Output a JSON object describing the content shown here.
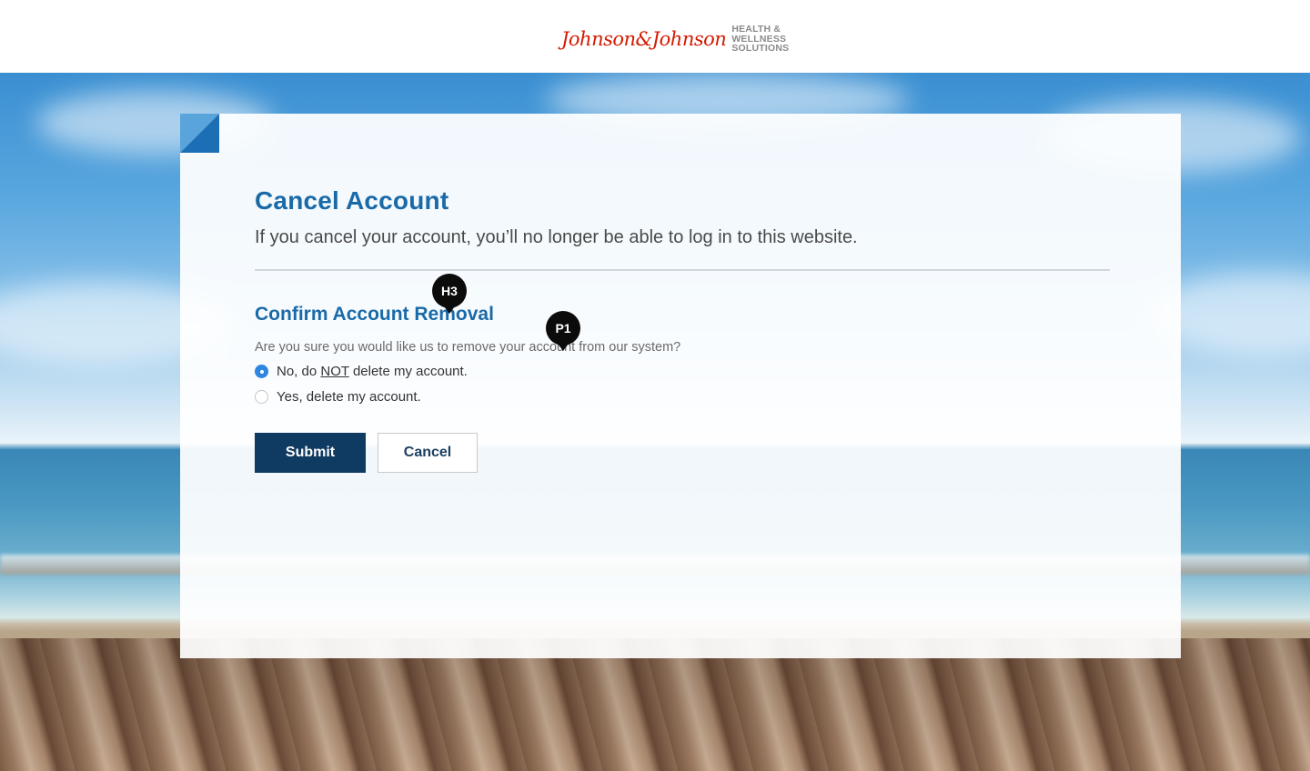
{
  "header": {
    "logo_script": "Johnson&Johnson",
    "logo_sub_line1": "HEALTH &",
    "logo_sub_line2": "WELLNESS",
    "logo_sub_line3": "SOLUTIONS"
  },
  "page": {
    "title": "Cancel Account",
    "subtitle": "If you cancel your account, you’ll no longer be able to log in to this website."
  },
  "confirm": {
    "heading": "Confirm Account Removal",
    "question": "Are you sure you would like us to remove your account from our system?",
    "option_no_prefix": "No, do ",
    "option_no_emphasis": "NOT",
    "option_no_suffix": " delete my account.",
    "option_yes": "Yes, delete my account.",
    "selected": "no"
  },
  "actions": {
    "submit_label": "Submit",
    "cancel_label": "Cancel"
  },
  "annotations": {
    "h3_label": "H3",
    "p1_label": "P1"
  },
  "colors": {
    "brand_red": "#d51900",
    "heading_blue": "#1a6aa8",
    "submit_navy": "#0f3a62",
    "radio_blue": "#2f86e0"
  }
}
